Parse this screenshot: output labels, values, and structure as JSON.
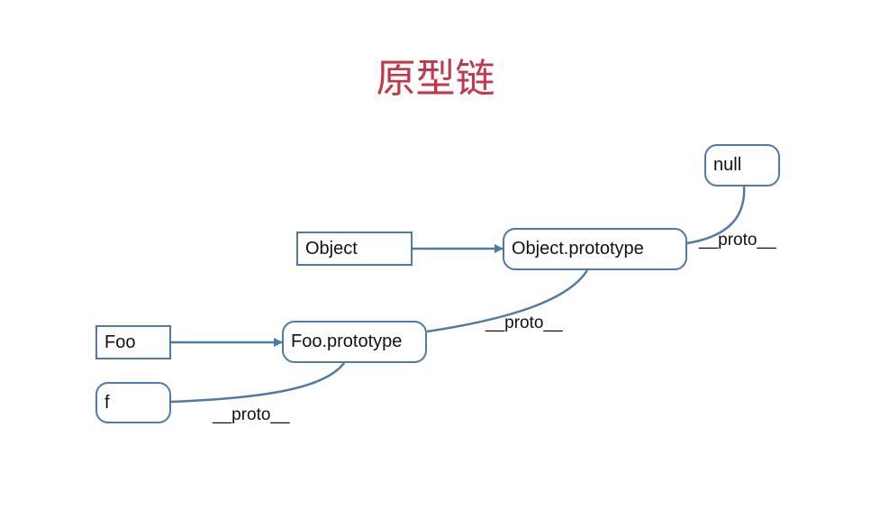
{
  "title": "原型链",
  "nodes": {
    "null": "null",
    "object": "Object",
    "object_prototype": "Object.prototype",
    "foo": "Foo",
    "foo_prototype": "Foo.prototype",
    "f": "f"
  },
  "edge_labels": {
    "object_prototype_to_null": "__proto__",
    "foo_prototype_to_object_prototype": "__proto__",
    "f_to_foo_prototype": "__proto__"
  },
  "colors": {
    "title": "#c0394b",
    "line": "#4f7aa6",
    "text": "#111111"
  }
}
